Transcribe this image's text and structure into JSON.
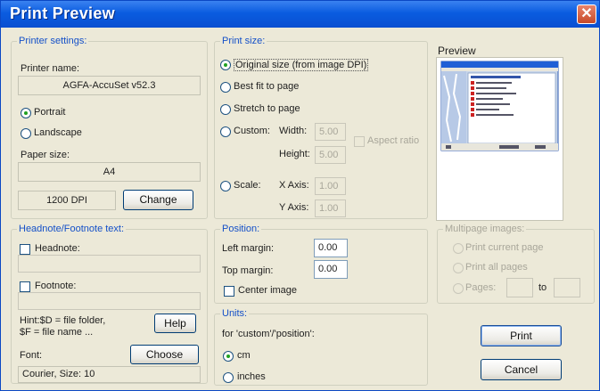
{
  "window": {
    "title": "Print Preview"
  },
  "printer": {
    "group_label": "Printer settings:",
    "name_label": "Printer name:",
    "name_value": "AGFA-AccuSet v52.3",
    "orientation": [
      "Portrait",
      "Landscape"
    ],
    "orientation_selected": "Portrait",
    "paper_label": "Paper size:",
    "paper_value": "A4",
    "dpi_value": "1200 DPI",
    "change_label": "Change"
  },
  "print_size": {
    "group_label": "Print size:",
    "options": [
      "Original size (from image DPI)",
      "Best fit to page",
      "Stretch to page",
      "Custom:",
      "Scale:"
    ],
    "selected": "Original size (from image DPI)",
    "width_label": "Width:",
    "width_value": "5.00",
    "height_label": "Height:",
    "height_value": "5.00",
    "aspect_label": "Aspect ratio",
    "xaxis_label": "X Axis:",
    "xaxis_value": "1.00",
    "yaxis_label": "Y Axis:",
    "yaxis_value": "1.00"
  },
  "preview": {
    "label": "Preview"
  },
  "headnote": {
    "group_label": "Headnote/Footnote text:",
    "headnote_label": "Headnote:",
    "headnote_value": "",
    "footnote_label": "Footnote:",
    "footnote_value": "",
    "hint_line1": "Hint:$D = file folder,",
    "hint_line2": "$F = file name ...",
    "help_label": "Help",
    "font_label": "Font:",
    "choose_label": "Choose",
    "font_value": "Courier, Size: 10"
  },
  "position": {
    "group_label": "Position:",
    "left_label": "Left margin:",
    "left_value": "0.00",
    "top_label": "Top margin:",
    "top_value": "0.00",
    "center_label": "Center image"
  },
  "units": {
    "group_label": "Units:",
    "note": "for 'custom'/'position':",
    "options": [
      "cm",
      "inches"
    ],
    "selected": "cm"
  },
  "multipage": {
    "group_label": "Multipage images:",
    "options": [
      "Print current page",
      "Print all pages",
      "Pages:"
    ],
    "to_label": "to"
  },
  "buttons": {
    "print": "Print",
    "cancel": "Cancel"
  }
}
